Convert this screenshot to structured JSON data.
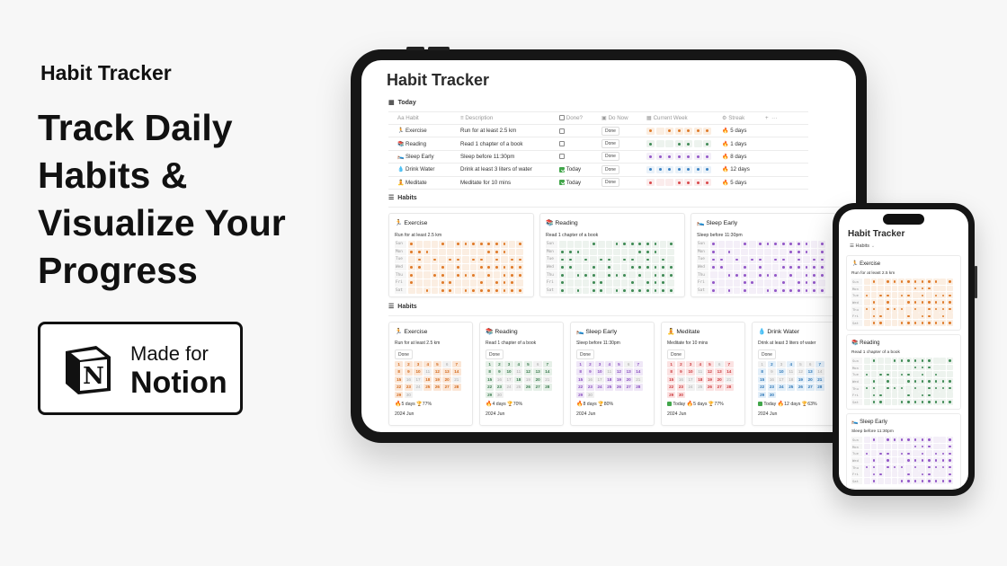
{
  "hero": {
    "brand": "Habit Tracker",
    "headline": "Track Daily Habits & Visualize Your Progress",
    "badge_made_for": "Made for",
    "badge_notion": "Notion",
    "notion_letter": "N"
  },
  "colors": {
    "exercise": {
      "dot": "#e07b2a",
      "bg": "#fbeee2",
      "num": "#d36a1c",
      "numbg": "#fbe6d6"
    },
    "reading": {
      "dot": "#3f8a55",
      "bg": "#edf3ee",
      "num": "#3c7c50",
      "numbg": "#e6f0e8"
    },
    "sleep": {
      "dot": "#9358c8",
      "bg": "#f4eff8",
      "num": "#8a4fc0",
      "numbg": "#efe7f7"
    },
    "water": {
      "dot": "#3a82c4",
      "bg": "#eaf2f9",
      "num": "#2f78b8",
      "numbg": "#e2eef8"
    },
    "meditate": {
      "dot": "#d9484b",
      "bg": "#fbecec",
      "num": "#cc3b3e",
      "numbg": "#fbe2e2"
    }
  },
  "tablet": {
    "title": "Habit Tracker",
    "today_label": "Today",
    "habits_label": "Habits",
    "table": {
      "headers": {
        "habit": "Habit",
        "description": "Description",
        "done": "Done?",
        "do_now": "Do Now",
        "current_week": "Current Week",
        "streak": "Streak",
        "add": "+",
        "more": "···"
      },
      "rows": [
        {
          "icon": "🏃",
          "habit": "Exercise",
          "description": "Run for at least 2.5 km",
          "done": false,
          "done_label": "",
          "button": "Done",
          "color": "exercise",
          "week": [
            1,
            0,
            1,
            1,
            1,
            1,
            1
          ],
          "streak": "5 days"
        },
        {
          "icon": "📚",
          "habit": "Reading",
          "description": "Read 1 chapter of a book",
          "done": false,
          "done_label": "",
          "button": "Done",
          "color": "reading",
          "week": [
            1,
            0,
            0,
            1,
            1,
            0,
            1
          ],
          "streak": "1 days"
        },
        {
          "icon": "🛌",
          "habit": "Sleep Early",
          "description": "Sleep before 11:30pm",
          "done": false,
          "done_label": "",
          "button": "Done",
          "color": "sleep",
          "week": [
            1,
            1,
            1,
            1,
            1,
            1,
            1
          ],
          "streak": "8 days"
        },
        {
          "icon": "💧",
          "habit": "Drink Water",
          "description": "Drink at least 3 liters of water",
          "done": true,
          "done_label": "Today",
          "button": "Done",
          "color": "water",
          "week": [
            1,
            1,
            1,
            1,
            1,
            1,
            1
          ],
          "streak": "12 days"
        },
        {
          "icon": "🧘",
          "habit": "Meditate",
          "description": "Meditate for 10 mins",
          "done": true,
          "done_label": "Today",
          "button": "Done",
          "color": "meditate",
          "week": [
            1,
            0,
            0,
            1,
            1,
            1,
            1
          ],
          "streak": "5 days"
        }
      ]
    },
    "grid_days": [
      "Sun",
      "Mon",
      "Tue",
      "Wed",
      "Thu",
      "Fri",
      "Sat"
    ],
    "grid_cards": [
      {
        "icon": "🏃",
        "name": "Exercise",
        "description": "Run for at least 2.5 km",
        "color": "exercise",
        "grid": [
          [
            1,
            0,
            0,
            0,
            1,
            0,
            1,
            1,
            1,
            1,
            1,
            1,
            1,
            0,
            1
          ],
          [
            1,
            1,
            1,
            0,
            0,
            0,
            0,
            0,
            0,
            0,
            1,
            1,
            1,
            0,
            0
          ],
          [
            0,
            1,
            0,
            1,
            0,
            1,
            1,
            0,
            1,
            1,
            0,
            1,
            0,
            1,
            1
          ],
          [
            1,
            1,
            0,
            0,
            1,
            0,
            1,
            0,
            0,
            1,
            1,
            1,
            1,
            1,
            1
          ],
          [
            1,
            0,
            0,
            1,
            1,
            0,
            1,
            1,
            1,
            0,
            1,
            0,
            1,
            1,
            1
          ],
          [
            1,
            0,
            0,
            0,
            1,
            1,
            0,
            0,
            0,
            1,
            0,
            1,
            1,
            1,
            0
          ],
          [
            0,
            0,
            1,
            0,
            1,
            1,
            0,
            1,
            1,
            1,
            1,
            1,
            1,
            1,
            1
          ]
        ]
      },
      {
        "icon": "📚",
        "name": "Reading",
        "description": "Read 1 chapter of a book",
        "color": "reading",
        "grid": [
          [
            0,
            0,
            0,
            0,
            1,
            0,
            0,
            1,
            1,
            1,
            1,
            1,
            1,
            0,
            1
          ],
          [
            1,
            1,
            1,
            0,
            0,
            0,
            0,
            0,
            0,
            0,
            1,
            1,
            1,
            0,
            0
          ],
          [
            1,
            1,
            0,
            1,
            0,
            1,
            1,
            0,
            1,
            1,
            0,
            1,
            0,
            1,
            0
          ],
          [
            1,
            1,
            0,
            0,
            1,
            0,
            1,
            0,
            0,
            1,
            1,
            1,
            1,
            1,
            1
          ],
          [
            1,
            0,
            1,
            1,
            1,
            0,
            1,
            1,
            1,
            0,
            1,
            0,
            1,
            1,
            1
          ],
          [
            1,
            0,
            0,
            0,
            1,
            1,
            0,
            0,
            0,
            1,
            0,
            1,
            1,
            1,
            0
          ],
          [
            1,
            0,
            1,
            0,
            1,
            1,
            0,
            1,
            1,
            1,
            1,
            1,
            1,
            1,
            1
          ]
        ]
      },
      {
        "icon": "🛌",
        "name": "Sleep Early",
        "description": "Sleep before 11:30pm",
        "color": "sleep",
        "grid": [
          [
            1,
            0,
            0,
            0,
            1,
            0,
            1,
            1,
            1,
            1,
            1,
            1,
            1,
            0,
            1
          ],
          [
            1,
            0,
            1,
            0,
            0,
            0,
            0,
            0,
            0,
            0,
            1,
            1,
            1,
            0,
            1
          ],
          [
            1,
            1,
            0,
            1,
            0,
            1,
            1,
            0,
            1,
            1,
            0,
            1,
            0,
            1,
            1
          ],
          [
            1,
            1,
            0,
            0,
            1,
            0,
            1,
            0,
            0,
            1,
            1,
            1,
            1,
            1,
            1
          ],
          [
            0,
            0,
            1,
            1,
            1,
            0,
            1,
            1,
            1,
            0,
            1,
            0,
            1,
            1,
            1
          ],
          [
            1,
            0,
            0,
            0,
            1,
            1,
            0,
            0,
            0,
            1,
            0,
            1,
            1,
            1,
            0
          ],
          [
            1,
            0,
            1,
            0,
            1,
            0,
            0,
            1,
            1,
            1,
            1,
            1,
            1,
            1,
            1
          ]
        ]
      }
    ],
    "calendar_cards": [
      {
        "icon": "🏃",
        "name": "Exercise",
        "description": "Run for at least 2.5 km",
        "button": "Done",
        "color": "exercise",
        "done_days": [
          1,
          2,
          3,
          4,
          5,
          7,
          8,
          9,
          10,
          12,
          13,
          14,
          15,
          18,
          19,
          20,
          22,
          23,
          25,
          26,
          27,
          28,
          29
        ],
        "today": "",
        "streak": "5 days",
        "rate": "77%",
        "month": "2024 Jun"
      },
      {
        "icon": "📚",
        "name": "Reading",
        "description": "Read 1 chapter of a book",
        "button": "Done",
        "color": "reading",
        "done_days": [
          1,
          2,
          3,
          4,
          5,
          7,
          8,
          9,
          10,
          12,
          13,
          14,
          15,
          18,
          20,
          22,
          23,
          26,
          27,
          28,
          29
        ],
        "today": "",
        "streak": "4 days",
        "rate": "70%",
        "month": "2024 Jun"
      },
      {
        "icon": "🛌",
        "name": "Sleep Early",
        "description": "Sleep before 11:30pm",
        "button": "Done",
        "color": "sleep",
        "done_days": [
          1,
          2,
          3,
          4,
          5,
          7,
          8,
          9,
          10,
          12,
          13,
          14,
          15,
          18,
          19,
          20,
          22,
          23,
          24,
          25,
          26,
          27,
          28,
          29
        ],
        "today": "",
        "streak": "8 days",
        "rate": "80%",
        "month": "2024 Jun"
      },
      {
        "icon": "🧘",
        "name": "Meditate",
        "description": "Meditate for 10 mins",
        "button": "Done",
        "color": "meditate",
        "done_days": [
          1,
          2,
          3,
          4,
          5,
          7,
          8,
          9,
          10,
          12,
          13,
          14,
          15,
          18,
          19,
          20,
          22,
          23,
          26,
          27,
          28,
          29,
          30
        ],
        "today": "Today",
        "streak": "5 days",
        "rate": "77%",
        "month": "2024 Jun"
      },
      {
        "icon": "💧",
        "name": "Drink Water",
        "description": "Drink at least 3 liters of water",
        "button": "Done",
        "color": "water",
        "done_days": [
          2,
          4,
          7,
          8,
          10,
          13,
          15,
          19,
          20,
          21,
          22,
          23,
          24,
          25,
          26,
          27,
          28,
          29,
          30
        ],
        "today": "Today",
        "streak": "12 days",
        "rate": "63%",
        "month": "2024 Jun"
      }
    ],
    "days_in_month": 30
  },
  "phone": {
    "title": "Habit Tracker",
    "view_label": "Habits",
    "view_chevron": "⌄",
    "cards": [
      {
        "icon": "🏃",
        "name": "Exercise",
        "description": "Run for at least 2.5 km",
        "color": "exercise",
        "grid": [
          [
            0,
            1,
            0,
            1,
            1,
            1,
            1,
            1,
            1,
            1,
            1,
            0,
            1
          ],
          [
            0,
            0,
            0,
            0,
            0,
            0,
            0,
            1,
            1,
            1,
            0,
            0,
            0
          ],
          [
            1,
            0,
            1,
            1,
            0,
            1,
            1,
            0,
            1,
            0,
            1,
            1,
            1
          ],
          [
            0,
            1,
            0,
            1,
            0,
            0,
            1,
            1,
            1,
            1,
            1,
            1,
            1
          ],
          [
            1,
            1,
            0,
            1,
            1,
            1,
            0,
            1,
            0,
            1,
            1,
            1,
            1
          ],
          [
            0,
            1,
            1,
            0,
            0,
            0,
            1,
            0,
            1,
            1,
            0,
            1,
            0
          ],
          [
            0,
            1,
            1,
            0,
            0,
            1,
            1,
            1,
            1,
            1,
            1,
            1,
            1
          ]
        ]
      },
      {
        "icon": "📚",
        "name": "Reading",
        "description": "Read 1 chapter of a book",
        "color": "reading",
        "grid": [
          [
            0,
            1,
            0,
            0,
            1,
            1,
            1,
            1,
            1,
            1,
            0,
            0,
            1
          ],
          [
            0,
            0,
            0,
            0,
            0,
            0,
            0,
            1,
            1,
            1,
            0,
            0,
            0
          ],
          [
            1,
            0,
            1,
            1,
            0,
            1,
            1,
            0,
            1,
            0,
            1,
            0,
            0
          ],
          [
            0,
            1,
            0,
            1,
            0,
            0,
            1,
            1,
            1,
            1,
            1,
            1,
            1
          ],
          [
            1,
            1,
            0,
            1,
            1,
            1,
            0,
            1,
            0,
            1,
            1,
            1,
            1
          ],
          [
            0,
            1,
            1,
            0,
            0,
            0,
            1,
            0,
            1,
            1,
            0,
            0,
            0
          ],
          [
            0,
            1,
            1,
            0,
            0,
            1,
            1,
            1,
            1,
            1,
            1,
            1,
            1
          ]
        ]
      },
      {
        "icon": "🛌",
        "name": "Sleep Early",
        "description": "Sleep before 11:30pm",
        "color": "sleep",
        "grid": [
          [
            0,
            1,
            0,
            1,
            1,
            1,
            1,
            1,
            1,
            1,
            0,
            0,
            1
          ],
          [
            0,
            0,
            0,
            0,
            0,
            0,
            0,
            1,
            1,
            1,
            0,
            0,
            1
          ],
          [
            1,
            0,
            1,
            1,
            0,
            1,
            1,
            0,
            1,
            0,
            1,
            1,
            1
          ],
          [
            0,
            1,
            0,
            1,
            0,
            0,
            1,
            1,
            1,
            1,
            1,
            1,
            1
          ],
          [
            1,
            1,
            0,
            1,
            1,
            1,
            0,
            1,
            0,
            1,
            1,
            1,
            1
          ],
          [
            0,
            1,
            1,
            0,
            0,
            0,
            1,
            0,
            1,
            1,
            0,
            0,
            1
          ],
          [
            0,
            1,
            0,
            0,
            0,
            1,
            1,
            1,
            1,
            1,
            1,
            1,
            1
          ]
        ]
      }
    ]
  }
}
